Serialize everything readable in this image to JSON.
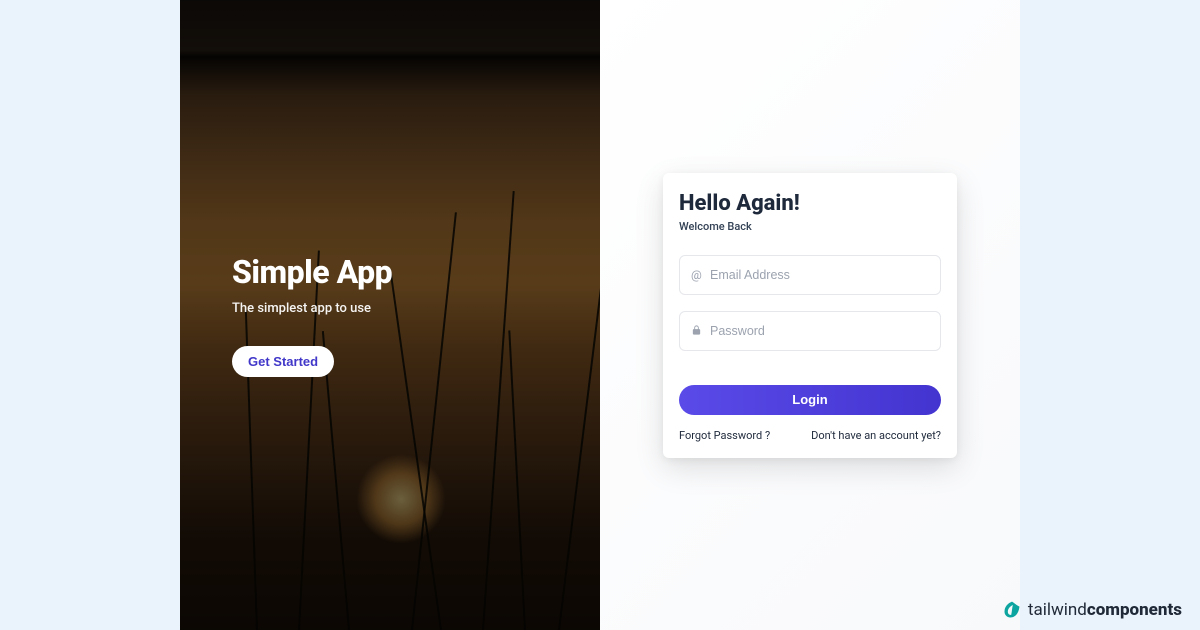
{
  "colors": {
    "accent": "#4f3fe0",
    "brand": "#0ea5a0"
  },
  "hero": {
    "title": "Simple App",
    "tagline": "The simplest app to use",
    "cta_label": "Get Started"
  },
  "login": {
    "title": "Hello Again!",
    "subtitle": "Welcome Back",
    "email_placeholder": "Email Address",
    "password_placeholder": "Password",
    "submit_label": "Login",
    "forgot_label": "Forgot Password ?",
    "signup_label": "Don't have an account yet?"
  },
  "footer": {
    "brand_prefix": "tailwind",
    "brand_suffix": "components"
  }
}
